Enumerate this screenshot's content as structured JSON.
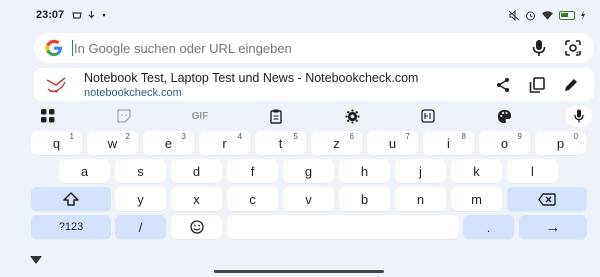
{
  "status_bar": {
    "time": "23:07",
    "left_icons": [
      "notification-icon",
      "download-icon",
      "more-dots-icon"
    ],
    "right_icons": [
      "mute-icon",
      "alarm-icon",
      "wifi-icon",
      "battery-charging-icon",
      "charging-bolt-icon"
    ]
  },
  "omnibox": {
    "placeholder": "In Google suchen oder URL eingeben",
    "value": "",
    "icons": [
      "google-logo",
      "mic-icon",
      "lens-camera-icon"
    ]
  },
  "suggestion": {
    "title": "Notebook Test, Laptop Test und News - Notebookcheck.com",
    "url": "notebookcheck.com",
    "actions": [
      "share-icon",
      "copy-icon",
      "edit-icon"
    ]
  },
  "keyboard": {
    "toolbar": [
      "apps-grid-icon",
      "sticker-icon",
      "GIF",
      "clipboard-icon",
      "settings-gear-icon",
      "translate-icon",
      "palette-icon",
      "mic-icon"
    ],
    "row1": [
      {
        "label": "q",
        "hint": "1"
      },
      {
        "label": "w",
        "hint": "2"
      },
      {
        "label": "e",
        "hint": "3"
      },
      {
        "label": "r",
        "hint": "4"
      },
      {
        "label": "t",
        "hint": "5"
      },
      {
        "label": "z",
        "hint": "6"
      },
      {
        "label": "u",
        "hint": "7"
      },
      {
        "label": "i",
        "hint": "8"
      },
      {
        "label": "o",
        "hint": "9"
      },
      {
        "label": "p",
        "hint": "0"
      }
    ],
    "row2": [
      "a",
      "s",
      "d",
      "f",
      "g",
      "h",
      "j",
      "k",
      "l"
    ],
    "row3": [
      "y",
      "x",
      "c",
      "v",
      "b",
      "n",
      "m"
    ],
    "row4": {
      "symbols": "?123",
      "slash": "/",
      "emoji": "☺",
      "space": "",
      "period": ".",
      "enter": "→"
    },
    "shift_icon": "shift-icon",
    "backspace_icon": "backspace-icon",
    "colors": {
      "background": "#eef2f9",
      "key": "#ffffff",
      "function_key": "#d3e3fd"
    }
  }
}
